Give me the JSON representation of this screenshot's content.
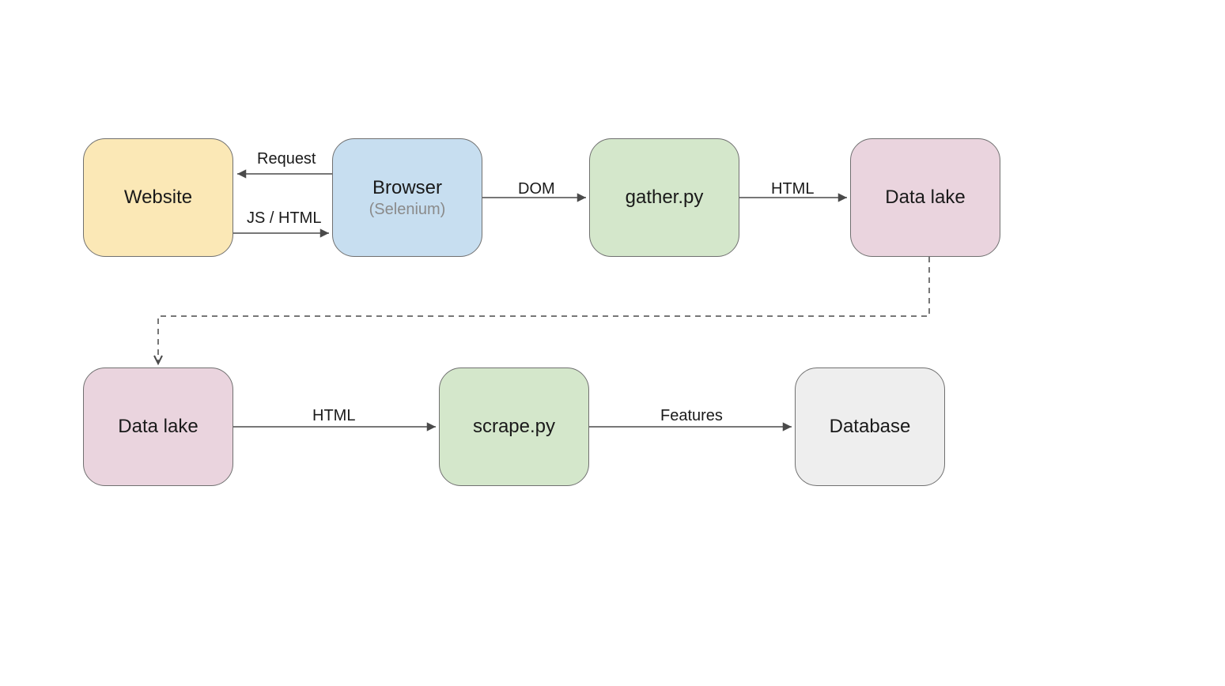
{
  "nodes": {
    "website": {
      "label": "Website",
      "sublabel": "",
      "fill": "#FBE8B6"
    },
    "browser": {
      "label": "Browser",
      "sublabel": "(Selenium)",
      "fill": "#C7DEF0"
    },
    "gather": {
      "label": "gather.py",
      "sublabel": "",
      "fill": "#D4E7CB"
    },
    "datalake1": {
      "label": "Data lake",
      "sublabel": "",
      "fill": "#EAD4DE"
    },
    "datalake2": {
      "label": "Data lake",
      "sublabel": "",
      "fill": "#EAD4DE"
    },
    "scrape": {
      "label": "scrape.py",
      "sublabel": "",
      "fill": "#D4E7CB"
    },
    "database": {
      "label": "Database",
      "sublabel": "",
      "fill": "#EEEEEE"
    }
  },
  "edges": {
    "request": "Request",
    "jshtml": "JS / HTML",
    "dom": "DOM",
    "html1": "HTML",
    "html2": "HTML",
    "features": "Features"
  }
}
